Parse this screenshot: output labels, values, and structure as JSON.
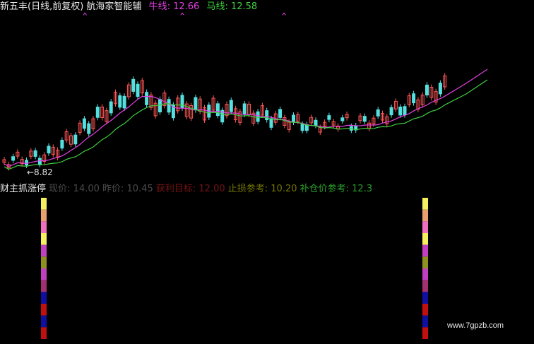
{
  "header": {
    "title": "新五丰(日线,前复权) 航海家智能辅",
    "bull_label": "牛线: 12.66",
    "horse_label": "马线: 12.58",
    "title_color": "#e8e8e8",
    "bull_color": "#e040e0",
    "horse_color": "#40d040"
  },
  "chart": {
    "min_price_label": "←8.82",
    "colors": {
      "up_candle": "#ff5555",
      "down_candle": "#55e0e0",
      "bull_line": "#e040e0",
      "horse_line": "#40d040"
    }
  },
  "lower_panel": {
    "label_a": "财主抓涨停",
    "label_b": "现价: 14.00 昨价: 10.45",
    "label_c": "获利目标: 12.00",
    "label_d": "止损参考: 10.20",
    "label_e": "补仓价参考: 12.3",
    "signal_colors": [
      "#f4f060",
      "#e8a070",
      "#f070c0",
      "#f4f060",
      "#c040c0",
      "#909020",
      "#c040c0",
      "#a03070",
      "#1010a0",
      "#c01010",
      "#1010a0",
      "#c01010"
    ]
  },
  "watermark": "www.7gpzb.com"
}
